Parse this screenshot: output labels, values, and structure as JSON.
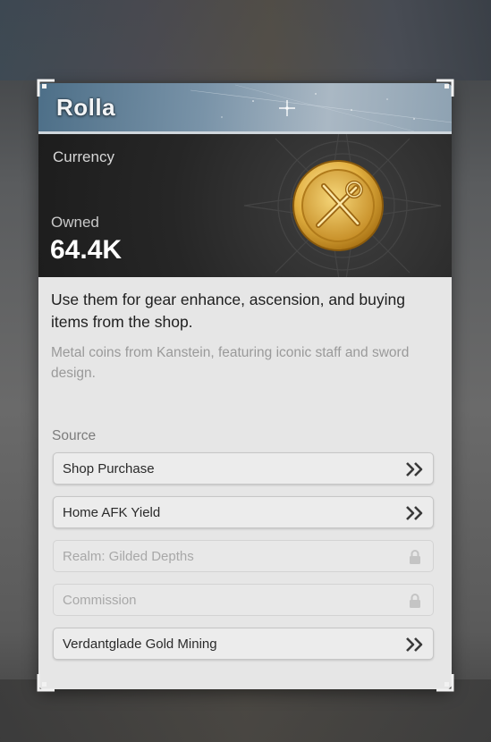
{
  "item": {
    "name": "Rolla",
    "type": "Currency",
    "owned_label": "Owned",
    "owned_value": "64.4K",
    "description": "Use them for gear enhance, ascension, and buying items from the shop.",
    "flavor": "Metal coins from Kanstein, featuring iconic staff and sword design.",
    "icon": "gold-coin-icon"
  },
  "source": {
    "label": "Source",
    "items": [
      {
        "label": "Shop Purchase",
        "locked": false,
        "icon": "double-chevron-right-icon"
      },
      {
        "label": "Home AFK Yield",
        "locked": false,
        "icon": "double-chevron-right-icon"
      },
      {
        "label": "Realm: Gilded Depths",
        "locked": true,
        "icon": "lock-icon"
      },
      {
        "label": "Commission",
        "locked": true,
        "icon": "lock-icon"
      },
      {
        "label": "Verdantglade Gold Mining",
        "locked": false,
        "icon": "double-chevron-right-icon"
      }
    ]
  },
  "colors": {
    "title_bar": "#6f8aa0",
    "card_bg": "#e6e6e6",
    "hero_bg": "#262626",
    "coin_gold": "#d9a832"
  }
}
